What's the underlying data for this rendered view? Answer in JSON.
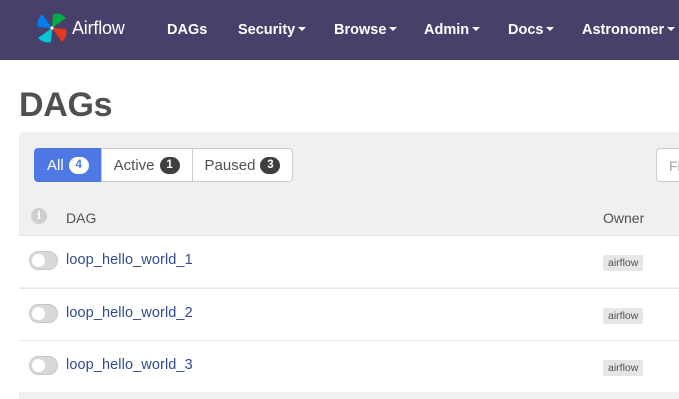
{
  "navbar": {
    "brand": "Airflow",
    "items": [
      {
        "label": "DAGs",
        "dropdown": false
      },
      {
        "label": "Security",
        "dropdown": true
      },
      {
        "label": "Browse",
        "dropdown": true
      },
      {
        "label": "Admin",
        "dropdown": true
      },
      {
        "label": "Docs",
        "dropdown": true
      },
      {
        "label": "Astronomer",
        "dropdown": true
      }
    ],
    "background_color": "#483f6b"
  },
  "page": {
    "title": "DAGs"
  },
  "filters": [
    {
      "label": "All",
      "count": "4",
      "active": true
    },
    {
      "label": "Active",
      "count": "1",
      "active": false
    },
    {
      "label": "Paused",
      "count": "3",
      "active": false
    }
  ],
  "search": {
    "placeholder": "Fi"
  },
  "table": {
    "info_icon": "i",
    "columns": [
      "DAG",
      "Owner"
    ],
    "rows": [
      {
        "dag_id": "loop_hello_world_1",
        "owner": "airflow",
        "enabled": false
      },
      {
        "dag_id": "loop_hello_world_2",
        "owner": "airflow",
        "enabled": false
      },
      {
        "dag_id": "loop_hello_world_3",
        "owner": "airflow",
        "enabled": false
      }
    ]
  },
  "colors": {
    "accent": "#4e79e5",
    "link": "#2f4b8f",
    "panel": "#f0f0f0"
  }
}
